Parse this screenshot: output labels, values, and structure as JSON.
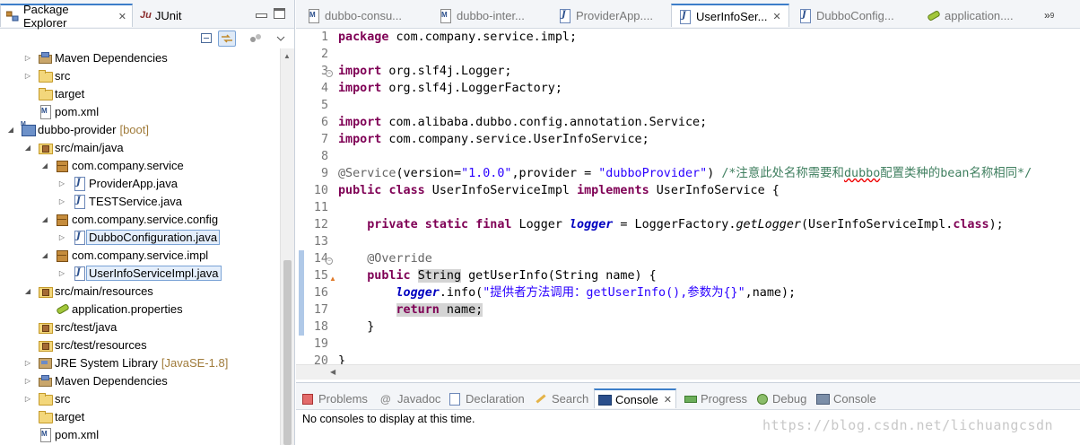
{
  "left_panel": {
    "tabs": [
      {
        "label": "Package Explorer",
        "active": true
      },
      {
        "label": "JUnit",
        "active": false
      }
    ],
    "tree": [
      {
        "label": "Maven Dependencies",
        "icon": "jar-icon",
        "indent": 1,
        "expanded": false
      },
      {
        "label": "src",
        "icon": "folder-icon",
        "indent": 1,
        "expanded": false
      },
      {
        "label": "target",
        "icon": "folder-icon",
        "indent": 1,
        "expanded": null
      },
      {
        "label": "pom.xml",
        "icon": "xml-file-icon",
        "indent": 1,
        "expanded": null
      },
      {
        "label": "dubbo-provider",
        "decoration": "[boot]",
        "icon": "maven-project-icon",
        "indent": 0,
        "expanded": true
      },
      {
        "label": "src/main/java",
        "icon": "source-folder-icon",
        "indent": 1,
        "expanded": true
      },
      {
        "label": "com.company.service",
        "icon": "package-icon",
        "indent": 2,
        "expanded": true
      },
      {
        "label": "ProviderApp.java",
        "icon": "java-file-icon",
        "indent": 3,
        "expanded": false
      },
      {
        "label": "TESTService.java",
        "icon": "java-file-icon",
        "indent": 3,
        "expanded": false
      },
      {
        "label": "com.company.service.config",
        "icon": "package-icon",
        "indent": 2,
        "expanded": true
      },
      {
        "label": "DubboConfiguration.java",
        "icon": "java-file-icon",
        "indent": 3,
        "expanded": false,
        "selected": true
      },
      {
        "label": "com.company.service.impl",
        "icon": "package-icon",
        "indent": 2,
        "expanded": true
      },
      {
        "label": "UserInfoServiceImpl.java",
        "icon": "java-file-icon",
        "indent": 3,
        "expanded": false,
        "selected": true
      },
      {
        "label": "src/main/resources",
        "icon": "source-folder-icon",
        "indent": 1,
        "expanded": true
      },
      {
        "label": "application.properties",
        "icon": "properties-file-icon",
        "indent": 2,
        "expanded": null
      },
      {
        "label": "src/test/java",
        "icon": "source-folder-icon",
        "indent": 1,
        "expanded": null
      },
      {
        "label": "src/test/resources",
        "icon": "source-folder-icon",
        "indent": 1,
        "expanded": null
      },
      {
        "label": "JRE System Library",
        "decoration": "[JavaSE-1.8]",
        "icon": "jre-library-icon",
        "indent": 1,
        "expanded": false
      },
      {
        "label": "Maven Dependencies",
        "icon": "jar-icon",
        "indent": 1,
        "expanded": false
      },
      {
        "label": "src",
        "icon": "folder-icon",
        "indent": 1,
        "expanded": false
      },
      {
        "label": "target",
        "icon": "folder-icon",
        "indent": 1,
        "expanded": null
      },
      {
        "label": "pom.xml",
        "icon": "xml-file-icon",
        "indent": 1,
        "expanded": null
      }
    ]
  },
  "editor": {
    "tabs": [
      {
        "label": "dubbo-consu...",
        "icon": "maven-file-icon",
        "active": false
      },
      {
        "label": "dubbo-inter...",
        "icon": "maven-file-icon",
        "active": false
      },
      {
        "label": "ProviderApp....",
        "icon": "java-file-icon",
        "active": false
      },
      {
        "label": "UserInfoSer...",
        "icon": "java-file-icon",
        "active": true
      },
      {
        "label": "DubboConfig...",
        "icon": "java-file-icon",
        "active": false
      },
      {
        "label": "application....",
        "icon": "properties-file-icon",
        "active": false
      }
    ],
    "overflow_count": "9",
    "lines": [
      {
        "no": "1"
      },
      {
        "no": "2"
      },
      {
        "no": "3"
      },
      {
        "no": "4"
      },
      {
        "no": "5"
      },
      {
        "no": "6"
      },
      {
        "no": "7"
      },
      {
        "no": "8"
      },
      {
        "no": "9"
      },
      {
        "no": "10"
      },
      {
        "no": "11"
      },
      {
        "no": "12"
      },
      {
        "no": "13"
      },
      {
        "no": "14"
      },
      {
        "no": "15"
      },
      {
        "no": "16"
      },
      {
        "no": "17"
      },
      {
        "no": "18"
      },
      {
        "no": "19"
      },
      {
        "no": "20"
      }
    ],
    "code": {
      "l1_kw": "package",
      "l1_rest": " com.company.service.impl;",
      "l3_kw": "import",
      "l3_rest": " org.slf4j.Logger;",
      "l4_kw": "import",
      "l4_rest": " org.slf4j.LoggerFactory;",
      "l6_kw": "import",
      "l6_rest": " com.alibaba.dubbo.config.annotation.Service;",
      "l7_kw": "import",
      "l7_rest": " com.company.service.UserInfoService;",
      "l9_ann": "@Service",
      "l9_a": "(version=",
      "l9_s1": "\"1.0.0\"",
      "l9_b": ",provider = ",
      "l9_s2": "\"dubboProvider\"",
      "l9_c": ") ",
      "l9_cmt1": "/*注意此处名称需要和",
      "l9_cmt_sq": "dubbo",
      "l9_cmt2": "配置类种的bean名称相同*/",
      "l10_kw1": "public",
      "l10_kw2": "class",
      "l10_name": " UserInfoServiceImpl ",
      "l10_kw3": "implements",
      "l10_rest": " UserInfoService {",
      "l12_kw1": "private",
      "l12_kw2": "static",
      "l12_kw3": "final",
      "l12_t": " Logger ",
      "l12_fld": "logger",
      "l12_eq": " = LoggerFactory.",
      "l12_m": "getLogger",
      "l12_arg": "(UserInfoServiceImpl.",
      "l12_kw4": "class",
      "l12_end": ");",
      "l14_ann": "@Override",
      "l15_kw": "public",
      "l15_type": "String",
      "l15_rest": " getUserInfo(String name) {",
      "l16_fld": "logger",
      "l16_a": ".info(",
      "l16_s": "\"提供者方法调用：getUserInfo(),参数为{}\"",
      "l16_b": ",name);",
      "l17_kw": "return",
      "l17_rest": " name;",
      "l18": "}",
      "l20": "}"
    }
  },
  "bottom_panel": {
    "tabs": [
      {
        "label": "Problems",
        "active": false
      },
      {
        "label": "Javadoc",
        "active": false
      },
      {
        "label": "Declaration",
        "active": false
      },
      {
        "label": "Search",
        "active": false
      },
      {
        "label": "Console",
        "active": true
      },
      {
        "label": "Progress",
        "active": false
      },
      {
        "label": "Debug",
        "active": false
      },
      {
        "label": "Console",
        "active": false
      }
    ],
    "console_message": "No consoles to display at this time.",
    "watermark": "https://blog.csdn.net/lichuangcsdn"
  }
}
